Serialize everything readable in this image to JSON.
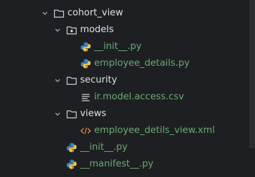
{
  "tree": {
    "root": {
      "label": "cohort_view",
      "icon": "folder-icon"
    },
    "models": {
      "label": "models",
      "icon": "package-icon"
    },
    "models_init": {
      "label": "__init__.py",
      "icon": "python-icon"
    },
    "employee_details": {
      "label": "employee_details.py",
      "icon": "python-icon"
    },
    "security": {
      "label": "security",
      "icon": "folder-icon"
    },
    "access_csv": {
      "label": "ir.model.access.csv",
      "icon": "csv-file-icon"
    },
    "views": {
      "label": "views",
      "icon": "folder-icon"
    },
    "view_xml": {
      "label": "employee_detils_view.xml",
      "icon": "xml-file-icon"
    },
    "root_init": {
      "label": "__init__.py",
      "icon": "python-icon"
    },
    "manifest": {
      "label": "__manifest__.py",
      "icon": "python-icon"
    }
  },
  "colors": {
    "background": "#1e1f22",
    "modified_text": "#6aab73",
    "normal_text": "#dfe1e5",
    "python_blue": "#3d86c6",
    "python_yellow": "#f5c542",
    "xml_orange": "#d98b4a"
  }
}
